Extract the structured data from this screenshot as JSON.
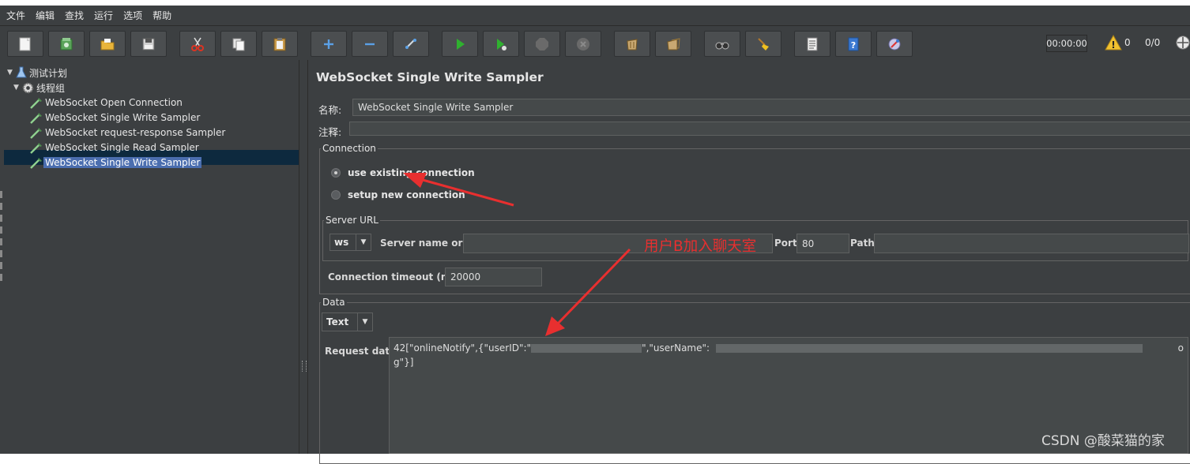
{
  "menu": [
    "文件",
    "编辑",
    "查找",
    "运行",
    "选项",
    "帮助"
  ],
  "toolbar": {
    "buttons": [
      {
        "icon": "new-file-icon"
      },
      {
        "icon": "templates-icon"
      },
      {
        "icon": "open-folder-icon"
      },
      {
        "icon": "save-icon"
      },
      {
        "icon": "cut-icon"
      },
      {
        "icon": "copy-icon"
      },
      {
        "icon": "paste-icon"
      },
      {
        "icon": "expand-plus-icon"
      },
      {
        "icon": "collapse-minus-icon"
      },
      {
        "icon": "toggle-icon"
      },
      {
        "icon": "start-icon"
      },
      {
        "icon": "start-no-pause-icon"
      },
      {
        "icon": "stop-icon"
      },
      {
        "icon": "shutdown-icon"
      },
      {
        "icon": "clear-icon"
      },
      {
        "icon": "clear-all-icon"
      },
      {
        "icon": "search-binoculars-icon"
      },
      {
        "icon": "reset-search-broom-icon"
      },
      {
        "icon": "function-helper-list-icon"
      },
      {
        "icon": "help-icon"
      },
      {
        "icon": "remote-icon"
      }
    ],
    "timer": "00:00:00",
    "warning_count": "0",
    "threads": "0/0"
  },
  "tree": {
    "root": "测试计划",
    "group": "线程组",
    "samplers": [
      "WebSocket Open Connection",
      "WebSocket Single Write Sampler",
      "WebSocket request-response Sampler",
      "WebSocket Single Read Sampler",
      "WebSocket Single Write Sampler"
    ]
  },
  "panel": {
    "title": "WebSocket Single Write Sampler",
    "name_label": "名称:",
    "name_value": "WebSocket Single Write Sampler",
    "comment_label": "注释:",
    "comment_value": "",
    "connection": {
      "legend": "Connection",
      "option_existing": "use existing connection",
      "option_new": "setup new connection",
      "selected": "use existing connection"
    },
    "server": {
      "legend": "Server URL",
      "protocol": "ws",
      "host_label": "Server name or IP:",
      "host_value": "",
      "port_label": "Port:",
      "port_value": "80",
      "path_label": "Path:",
      "path_value": ""
    },
    "timeout": {
      "label": "Connection timeout (ms):",
      "value": "20000"
    },
    "data": {
      "legend": "Data",
      "type": "Text",
      "request_label": "Request data:",
      "line1_a": "42[\"onlineNotify\",{\"userID\":\"",
      "line1_b": "\",\"userName\":",
      "line1_end": "o",
      "line2": "g\"}]"
    }
  },
  "annotation": "用户B加入聊天室",
  "watermark": "CSDN @酸菜猫的家",
  "colors": {
    "annotation_red": "#e82f2f",
    "selection": "#4b6eaf",
    "background": "#3c3f41"
  }
}
